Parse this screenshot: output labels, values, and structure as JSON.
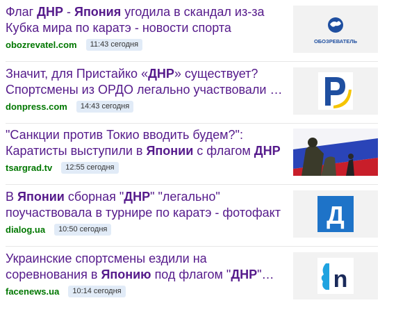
{
  "news": [
    {
      "title": [
        {
          "t": "Флаг ",
          "b": false
        },
        {
          "t": "ДНР",
          "b": true
        },
        {
          "t": " - ",
          "b": false
        },
        {
          "t": "Япония",
          "b": true
        },
        {
          "t": " угодила в скандал из-за Кубка мира по каратэ - новости спорта",
          "b": false
        }
      ],
      "source": "obozrevatel.com",
      "time": "11:43 сегодня",
      "logo_text": "ОБОЗРЕВАТЕЛЬ",
      "logo_icon": "obozrevatel-logo",
      "logo_color": "#1f4fa0"
    },
    {
      "title": [
        {
          "t": "Значит, для Пристайко «",
          "b": false
        },
        {
          "t": "ДНР",
          "b": true
        },
        {
          "t": "» существует? Спортсмены из ОРДО легально участвовали …",
          "b": false
        }
      ],
      "source": "donpress.com",
      "time": "14:43 сегодня",
      "logo_icon": "donpress-logo",
      "logo_color": "#1f4fa0",
      "logo_accent": "#f5c400"
    },
    {
      "title": [
        {
          "t": "\"Санкции против Токио вводить будем?\": Каратисты выступили в ",
          "b": false
        },
        {
          "t": "Японии",
          "b": true
        },
        {
          "t": " с флагом ",
          "b": false
        },
        {
          "t": "ДНР",
          "b": true
        }
      ],
      "source": "tsargrad.tv",
      "time": "12:55 сегодня",
      "logo_icon": "soldiers-photo"
    },
    {
      "title": [
        {
          "t": "В ",
          "b": false
        },
        {
          "t": "Японии",
          "b": true
        },
        {
          "t": " сборная \"",
          "b": false
        },
        {
          "t": "ДНР",
          "b": true
        },
        {
          "t": "\" \"легально\" поучаствовала в турнире по каратэ - фотофакт",
          "b": false
        }
      ],
      "source": "dialog.ua",
      "time": "10:50 сегодня",
      "logo_text": "Д",
      "logo_icon": "dialog-logo",
      "logo_color": "#1e73c8"
    },
    {
      "title": [
        {
          "t": "Украинские спортсмены ездили на соревнования в ",
          "b": false
        },
        {
          "t": "Японию",
          "b": true
        },
        {
          "t": " под флагом \"",
          "b": false
        },
        {
          "t": "ДНР",
          "b": true
        },
        {
          "t": "\"…",
          "b": false
        }
      ],
      "source": "facenews.ua",
      "time": "10:14 сегодня",
      "logo_text": "n",
      "logo_icon": "facenews-logo",
      "logo_color": "#1a2a5a",
      "logo_accent": "#1fa3e0"
    }
  ]
}
